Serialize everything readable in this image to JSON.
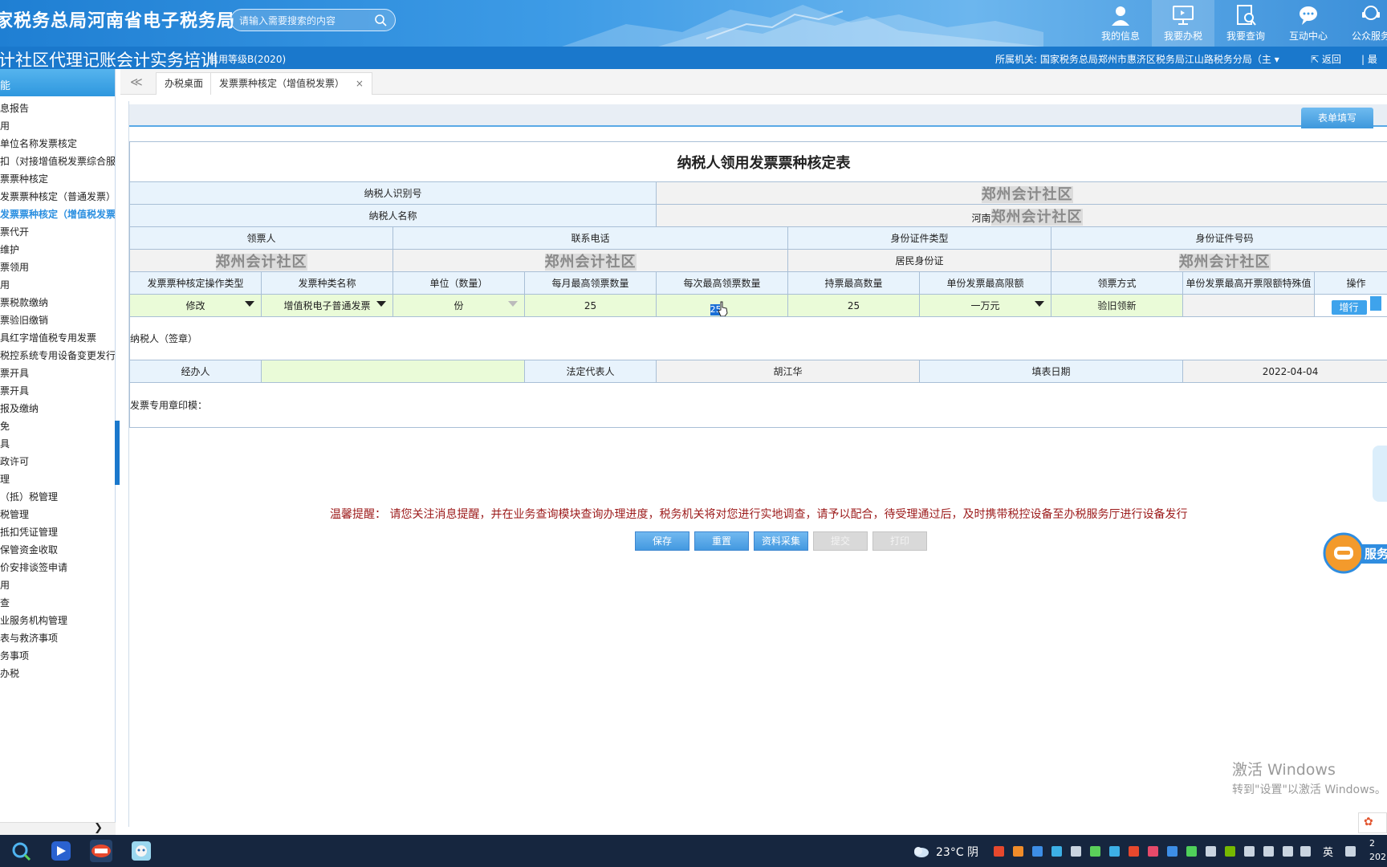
{
  "header": {
    "site_title": "家税务总局河南省电子税务局",
    "search_placeholder": "请输入需要搜索的内容",
    "nav": [
      {
        "label": "我的信息",
        "icon": "user-icon"
      },
      {
        "label": "我要办税",
        "icon": "monitor-icon"
      },
      {
        "label": "我要查询",
        "icon": "query-icon"
      },
      {
        "label": "互动中心",
        "icon": "chat-icon"
      },
      {
        "label": "公众服务",
        "icon": "service-icon"
      }
    ]
  },
  "subbar": {
    "org_name": "计社区代理记账会计实务培训",
    "credit": "信用等级B(2020)",
    "tax_office": "所属机关:    国家税务总局郑州市惠济区税务局江山路税务分局（主",
    "back": "返回",
    "logout": "最"
  },
  "sidebar": {
    "head": "能",
    "items": [
      "息报告",
      "用",
      "单位名称发票核定",
      "扣（对接增值税发票综合服",
      "票票种核定",
      "发票票种核定（普通发票）",
      "发票票种核定（增值税发票）",
      "票代开",
      "维护",
      "票领用",
      "用",
      "票税款缴纳",
      "票验旧缴销",
      "具红字增值税专用发票",
      "税控系统专用设备变更发行",
      "票开具",
      "票开具",
      "报及缴纳",
      "免",
      "具",
      "政许可",
      "理",
      "（抵）税管理",
      "税管理",
      "抵扣凭证管理",
      "保管资金收取",
      "价安排谈签申请",
      "用",
      "查",
      "业服务机构管理",
      "表与救济事项",
      "务事项",
      "办税"
    ]
  },
  "tabs": {
    "back": "≪",
    "items": [
      {
        "label": "办税桌面"
      },
      {
        "label": "发票票种核定（增值税发票）",
        "close": "×"
      }
    ]
  },
  "form": {
    "tab_label": "表单填写",
    "title": "纳税人领用发票票种核定表",
    "taxpayer_id_label": "纳税人识别号",
    "taxpayer_id_value": "郑州会计社区",
    "taxpayer_name_label": "纳税人名称",
    "taxpayer_name_prefix": "河南",
    "taxpayer_name_value": "郑州会计社区",
    "receiver_headers": [
      "领票人",
      "联系电话",
      "身份证件类型",
      "身份证件号码"
    ],
    "receiver_values": {
      "name": "郑州会计社区",
      "phone": "郑州会计社区",
      "id_type": "居民身份证",
      "id_number": "郑州会计社区"
    },
    "grid_headers": [
      "发票票种核定操作类型",
      "发票种类名称",
      "单位（数量）",
      "每月最高领票数量",
      "每次最高领票数量",
      "持票最高数量",
      "单份发票最高限额",
      "领票方式",
      "单份发票最高开票限额特殊值",
      "操作"
    ],
    "grid_row": {
      "op_type": "修改",
      "invoice_kind": "增值税电子普通发票",
      "unit": "份",
      "monthly_max": "25",
      "per_time_max": "25",
      "hold_max": "25",
      "single_limit": "一万元",
      "method": "验旧领新",
      "special": "",
      "add_label": "增行"
    },
    "signature_label": "纳税人（签章）",
    "agent_label": "经办人",
    "agent_value": "",
    "legal_rep_label": "法定代表人",
    "legal_rep_value": "胡江华",
    "fill_date_label": "填表日期",
    "fill_date_value": "2022-04-04",
    "seal_label": "发票专用章印模："
  },
  "reminder": "温馨提醒：  请您关注消息提醒，并在业务查询模块查询办理进度，税务机关将对您进行实地调查，请予以配合，待受理通过后，及时携带税控设备至办税服务厅进行设备发行",
  "actions": {
    "save": "保存",
    "reset": "重置",
    "collect": "资料采集",
    "submit": "提交",
    "print": "打印"
  },
  "service_float": "服务",
  "win_activation": {
    "line1": "激活 Windows",
    "line2": "转到\"设置\"以激活 Windows。"
  },
  "taskbar": {
    "weather": "23°C  阴",
    "lang": "英",
    "clock_line1": "2",
    "clock_line2": "202"
  },
  "colors": {
    "header_blue": "#1f7fd3",
    "accent_blue": "#3ea3ec",
    "editable_green": "#eafbd8",
    "reminder_red": "#9c1a1a"
  }
}
